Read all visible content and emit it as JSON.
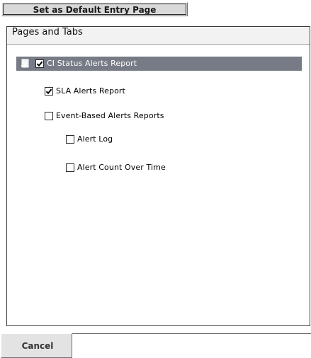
{
  "toolbar": {
    "default_entry_button": "Set as Default Entry Page"
  },
  "panel": {
    "title": "Pages and Tabs",
    "tree_icon": "expand-page-icon",
    "items": [
      {
        "label": "CI Status Alerts Report",
        "checked": true,
        "selected": true,
        "level": 0
      },
      {
        "label": "SLA Alerts Report",
        "checked": true,
        "selected": false,
        "level": 1
      },
      {
        "label": "Event-Based Alerts Reports",
        "checked": false,
        "selected": false,
        "level": 1
      },
      {
        "label": "Alert Log",
        "checked": false,
        "selected": false,
        "level": 2
      },
      {
        "label": "Alert Count Over Time",
        "checked": false,
        "selected": false,
        "level": 2
      }
    ]
  },
  "footer": {
    "cancel_label": "Cancel"
  },
  "colors": {
    "selected_row": "#767b85",
    "button_face": "#d9d9d9",
    "border_dark": "#3a3a3a"
  }
}
